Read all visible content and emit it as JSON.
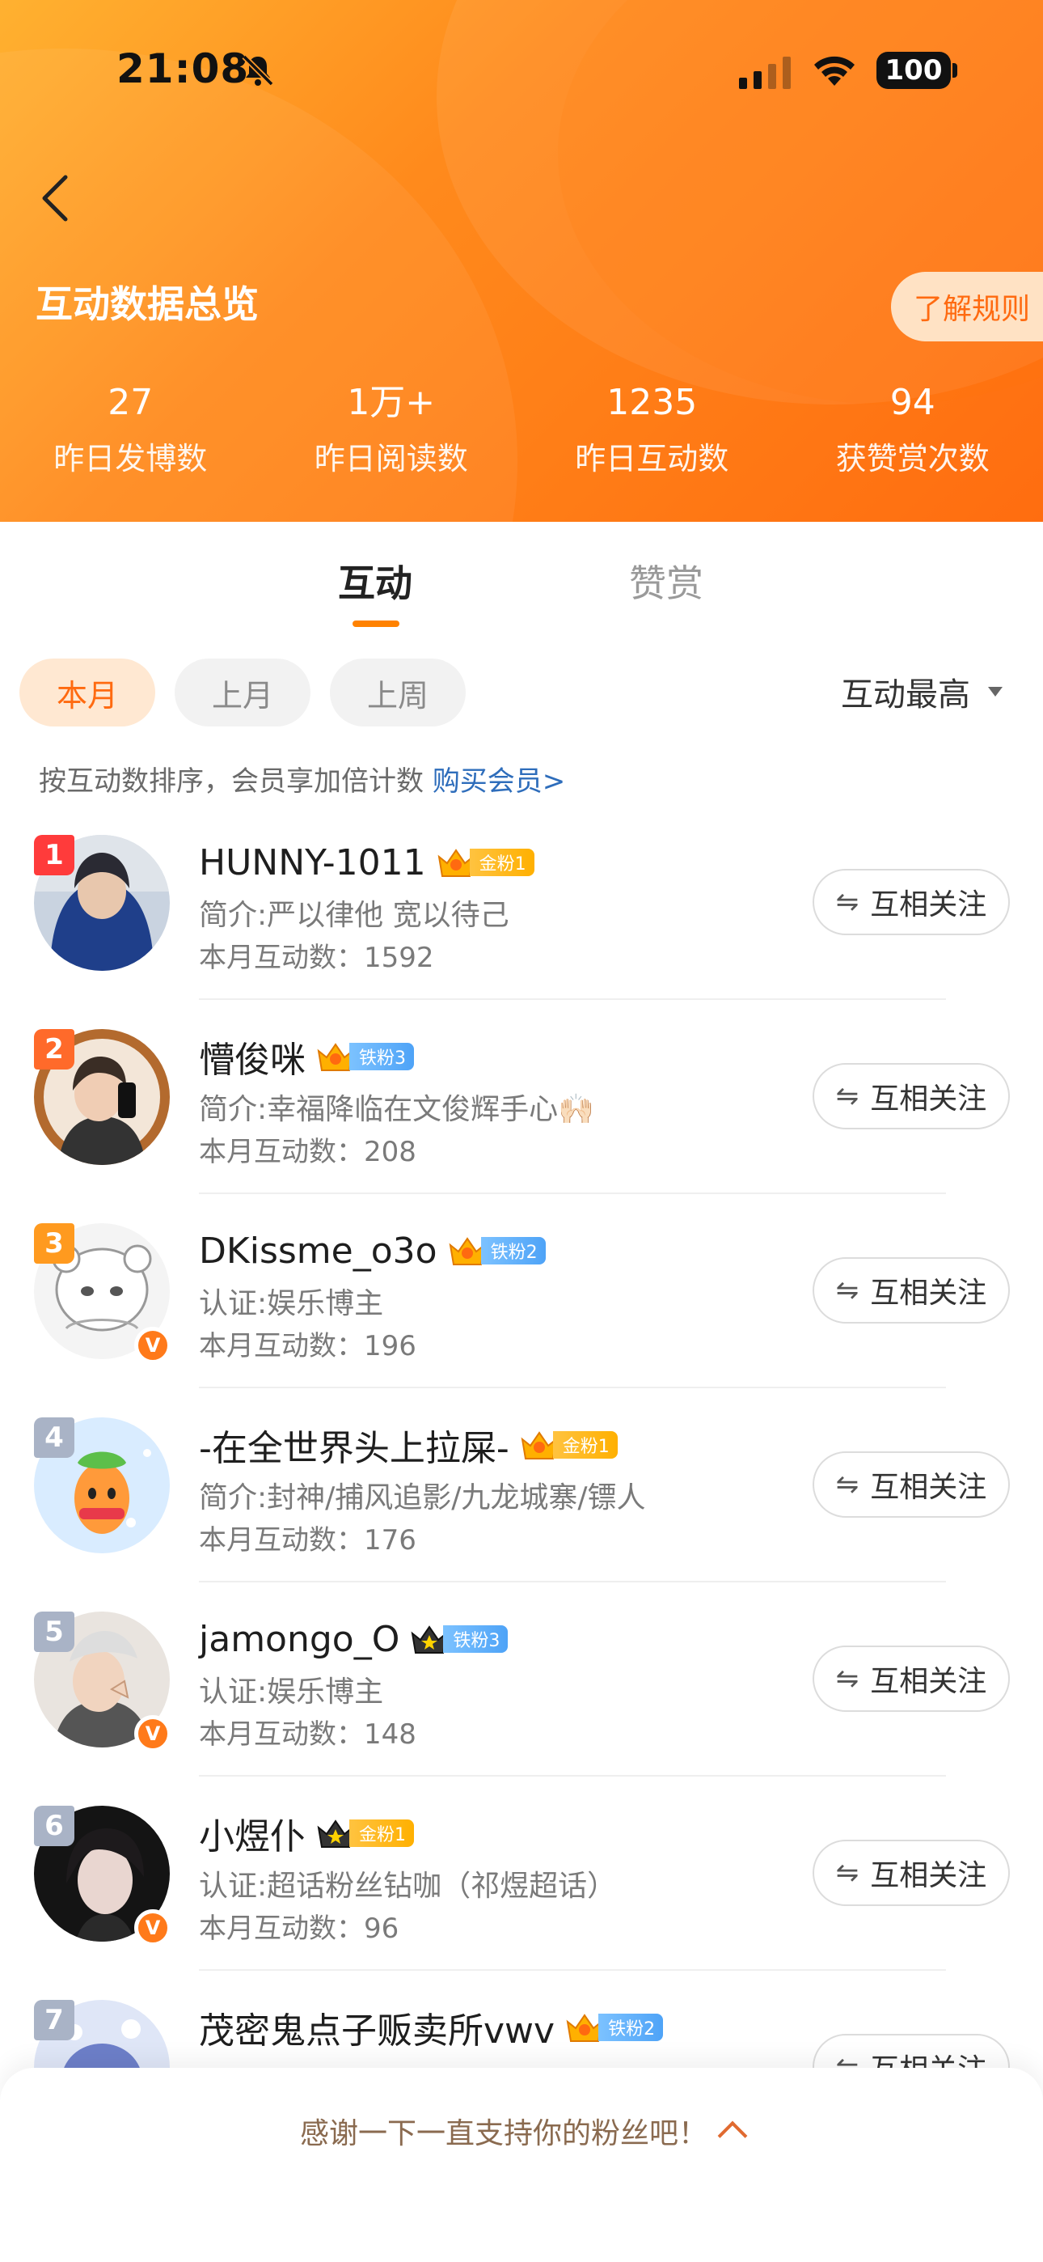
{
  "status_bar": {
    "time": "21:08",
    "battery": "100"
  },
  "header": {
    "title": "互动数据总览",
    "rules_label": "了解规则",
    "stats": [
      {
        "value": "27",
        "label": "昨日发博数"
      },
      {
        "value": "1万+",
        "label": "昨日阅读数"
      },
      {
        "value": "1235",
        "label": "昨日互动数"
      },
      {
        "value": "94",
        "label": "获赞赏次数"
      }
    ]
  },
  "tabs": {
    "interaction": "互动",
    "reward": "赞赏",
    "active": "互动"
  },
  "filters": {
    "this_month": "本月",
    "last_month": "上月",
    "last_week": "上周",
    "active": "本月",
    "sort": "互动最高"
  },
  "hint": {
    "text": "按互动数排序，会员享加倍计数 ",
    "link": "购买会员>"
  },
  "fans": [
    {
      "rank": "1",
      "name": "HUNNY-1011",
      "fan_level": "金粉1",
      "bio": "简介:严以律他 宽以待己",
      "count": "本月互动数：1592",
      "verified": false
    },
    {
      "rank": "2",
      "name": "懵俊咪",
      "fan_level": "铁粉3",
      "bio": "简介:幸福降临在文俊辉手心🙌🏻",
      "count": "本月互动数：208",
      "verified": false
    },
    {
      "rank": "3",
      "name": "DKissme_o3o",
      "fan_level": "铁粉2",
      "bio": "认证:娱乐博主",
      "count": "本月互动数：196",
      "verified": true
    },
    {
      "rank": "4",
      "name": "-在全世界头上拉屎-",
      "fan_level": "金粉1",
      "bio": "简介:封神/捕风追影/九龙城寨/镖人",
      "count": "本月互动数：176",
      "verified": false
    },
    {
      "rank": "5",
      "name": "jamongo_O",
      "fan_level": "铁粉3",
      "bio": "认证:娱乐博主",
      "count": "本月互动数：148",
      "verified": true
    },
    {
      "rank": "6",
      "name": "小煜仆",
      "fan_level": "金粉1",
      "bio": "认证:超话粉丝钻咖（祁煜超话）",
      "count": "本月互动数：96",
      "verified": true
    },
    {
      "rank": "7",
      "name": "茂密鬼点子贩卖所vwv",
      "fan_level": "铁粉2",
      "bio": "",
      "count": "",
      "verified": false
    }
  ],
  "follow_label": "互相关注",
  "bottom": {
    "thanks": "感谢一下一直支持你的粉丝吧！"
  },
  "colors": {
    "accent": "#ff8200",
    "gold_badge": "#ffb000",
    "iron_badge": "#4ea3f7",
    "link": "#2e6dbb"
  }
}
